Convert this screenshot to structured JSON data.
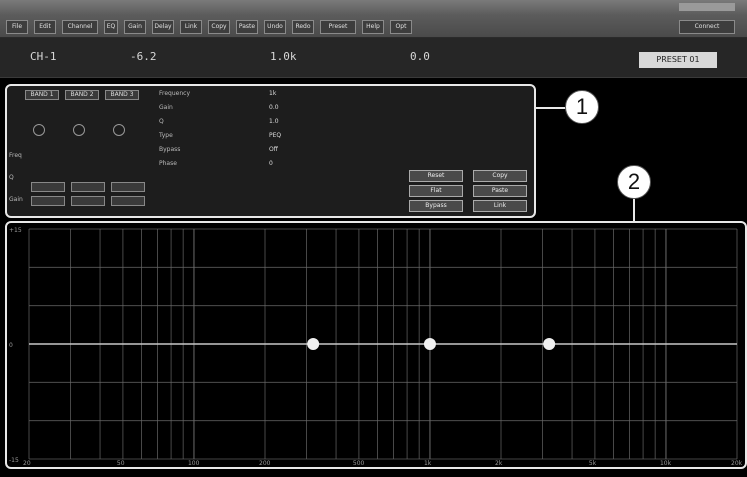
{
  "menubar": {
    "buttons": [
      "File",
      "Edit",
      "Channel",
      "EQ",
      "Gain",
      "Delay",
      "Link",
      "Copy",
      "Paste",
      "Undo",
      "Redo",
      "Preset",
      "Help",
      "Opt"
    ],
    "right_button": "Connect"
  },
  "infobar": {
    "items": [
      "CH-1",
      "-6.2",
      "1.0k",
      "0.0"
    ],
    "box_label": "PRESET 01"
  },
  "callouts": [
    "1",
    "2"
  ],
  "panel": {
    "bands": [
      "BAND 1",
      "BAND 2",
      "BAND 3"
    ],
    "row_labels": [
      "Freq",
      "Q",
      "Gain"
    ],
    "params": [
      {
        "label": "Frequency",
        "value": "1k"
      },
      {
        "label": "Gain",
        "value": "0.0"
      },
      {
        "label": "Q",
        "value": "1.0"
      },
      {
        "label": "Type",
        "value": "PEQ"
      },
      {
        "label": "Bypass",
        "value": "Off"
      },
      {
        "label": "Phase",
        "value": "0"
      }
    ],
    "actions": [
      "Reset",
      "Copy",
      "Flat",
      "Paste",
      "Bypass",
      "Link"
    ]
  },
  "graph": {
    "y_ticks": [
      "+15",
      "0",
      "-15"
    ],
    "x_ticks": [
      "20",
      "50",
      "100",
      "200",
      "500",
      "1k",
      "2k",
      "5k",
      "10k",
      "20k"
    ],
    "y_range": [
      -15,
      15
    ],
    "x_range": [
      20,
      20000
    ],
    "x_scale": "log",
    "curve_level_db": 0,
    "eq_points": [
      {
        "freq": 320,
        "gain": 0
      },
      {
        "freq": 1000,
        "gain": 0
      },
      {
        "freq": 3200,
        "gain": 0
      }
    ],
    "grid_color": "#6a6a6a",
    "curve_color": "#c8c8c8",
    "point_color": "#f0f0f0"
  }
}
